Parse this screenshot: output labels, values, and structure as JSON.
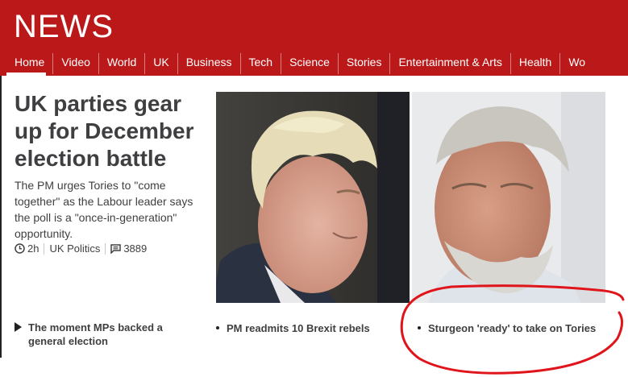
{
  "header": {
    "logo": "NEWS",
    "nav": [
      "Home",
      "Video",
      "World",
      "UK",
      "Business",
      "Tech",
      "Science",
      "Stories",
      "Entertainment & Arts",
      "Health",
      "Wo"
    ],
    "active": "Home",
    "color": "#bb1919"
  },
  "top_story": {
    "headline": "UK parties gear up for December election battle",
    "summary": "The PM urges Tories to \"come together\" as the Labour leader says the poll is a \"once-in-generation\" opportunity.",
    "time": "2h",
    "section": "UK Politics",
    "comments": "3889"
  },
  "related": [
    {
      "text": "The moment MPs backed a general election",
      "icon": "play-icon"
    },
    {
      "text": "PM readmits 10 Brexit rebels",
      "icon": "bullet-icon"
    },
    {
      "text": "Sturgeon 'ready' to take on Tories",
      "icon": "bullet-icon"
    }
  ],
  "annotation_color": "#e0141b"
}
